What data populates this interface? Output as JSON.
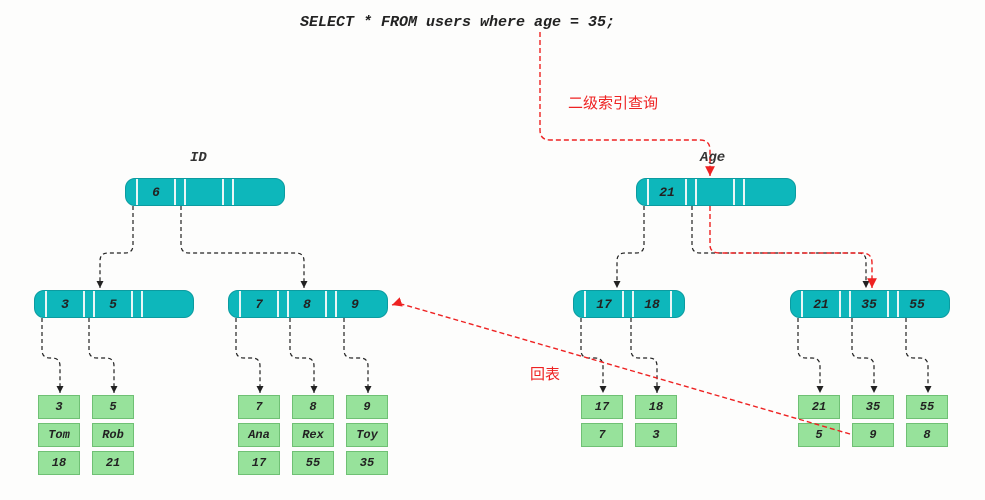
{
  "sql": "SELECT * FROM users where age = 35;",
  "annotations": {
    "secondary_index": "二级索引查询",
    "back_to_table": "回表"
  },
  "trees": {
    "id": {
      "label": "ID",
      "root": {
        "vals": [
          "6"
        ]
      },
      "mids": [
        {
          "vals": [
            "3",
            "5",
            ""
          ]
        },
        {
          "vals": [
            "7",
            "8",
            "9"
          ]
        }
      ],
      "leaves": [
        {
          "id": "3",
          "name": "Tom",
          "age": "18"
        },
        {
          "id": "5",
          "name": "Rob",
          "age": "21"
        },
        {
          "id": "7",
          "name": "Ana",
          "age": "17"
        },
        {
          "id": "8",
          "name": "Rex",
          "age": "55"
        },
        {
          "id": "9",
          "name": "Toy",
          "age": "35"
        }
      ]
    },
    "age": {
      "label": "Age",
      "root": {
        "vals": [
          "21"
        ]
      },
      "mids": [
        {
          "vals": [
            "17",
            "18"
          ]
        },
        {
          "vals": [
            "21",
            "35",
            "55"
          ]
        }
      ],
      "leaves": [
        {
          "age": "17",
          "id": "7"
        },
        {
          "age": "18",
          "id": "3"
        },
        {
          "age": "21",
          "id": "5"
        },
        {
          "age": "35",
          "id": "9"
        },
        {
          "age": "55",
          "id": "8"
        }
      ]
    }
  }
}
